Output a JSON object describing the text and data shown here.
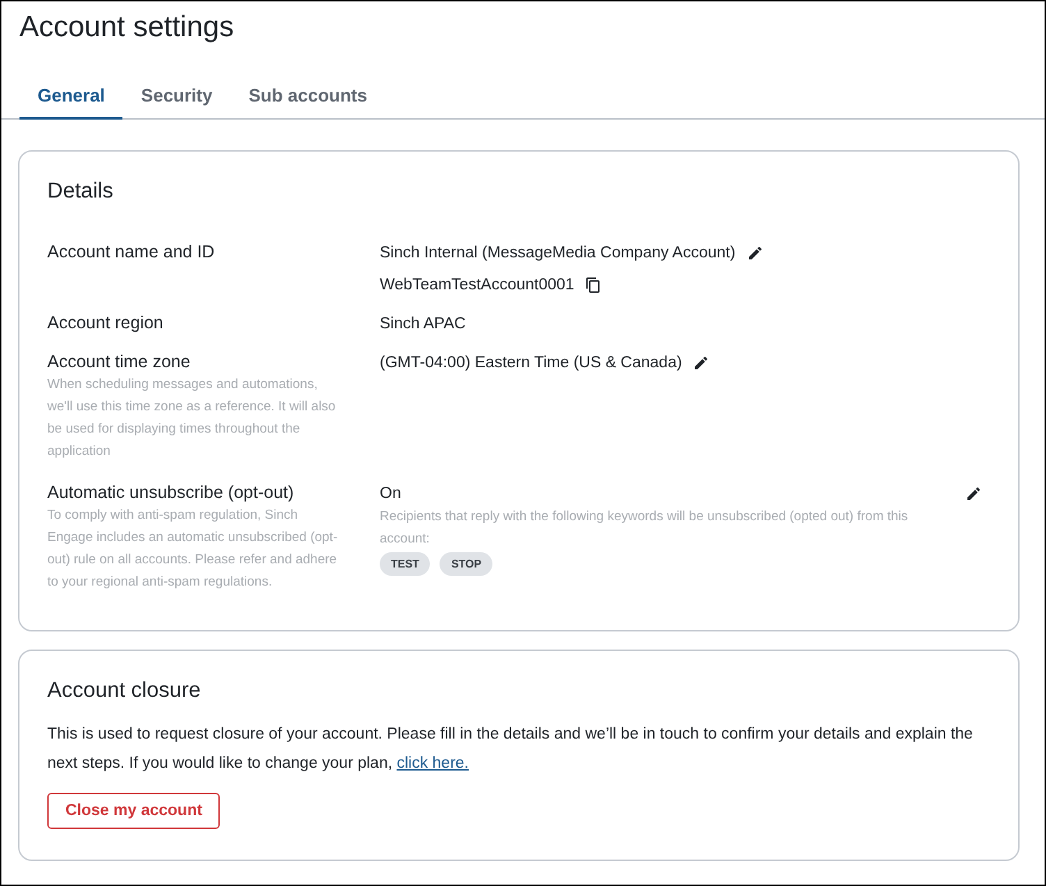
{
  "page": {
    "title": "Account settings"
  },
  "tabs": [
    {
      "label": "General",
      "selected": true
    },
    {
      "label": "Security",
      "selected": false
    },
    {
      "label": "Sub accounts",
      "selected": false
    }
  ],
  "details": {
    "title": "Details",
    "rows": [
      {
        "kind": "values",
        "label": "Account name and ID",
        "values": [
          {
            "text": "Sinch Internal (MessageMedia Company Account)",
            "editable": true,
            "copyable": false
          },
          {
            "text": "WebTeamTestAccount0001",
            "editable": false,
            "copyable": true
          }
        ]
      },
      {
        "kind": "values",
        "label": "Account region",
        "values": [
          {
            "text": "Sinch APAC",
            "editable": false,
            "copyable": false
          }
        ]
      },
      {
        "kind": "values",
        "label": "Account time zone",
        "description": "When scheduling messages and automations, we'll use this time zone as a reference. It will also be used for displaying times throughout the application",
        "values": [
          {
            "text": "(GMT-04:00) Eastern Time (US & Canada)",
            "editable": true,
            "copyable": false
          }
        ]
      },
      {
        "kind": "optout",
        "label": "Automatic unsubscribe (opt-out)",
        "description": "To comply with anti-spam regulation, Sinch Engage includes an automatic unsubscribed (opt-out) rule on all accounts. Please refer and adhere to your regional anti-spam regulations.",
        "value": "On",
        "editable": true,
        "note": "Recipients that reply with the following keywords will be unsubscribed (opted out) from this account:",
        "keywords": [
          "TEST",
          "STOP"
        ]
      }
    ]
  },
  "closure": {
    "title": "Account closure",
    "text": "This is used to request closure of your account. Please fill in the details and we’ll be in touch to confirm your details and explain the next steps. If you would like to change your plan, ",
    "link": "click here.",
    "button": "Close my account"
  }
}
